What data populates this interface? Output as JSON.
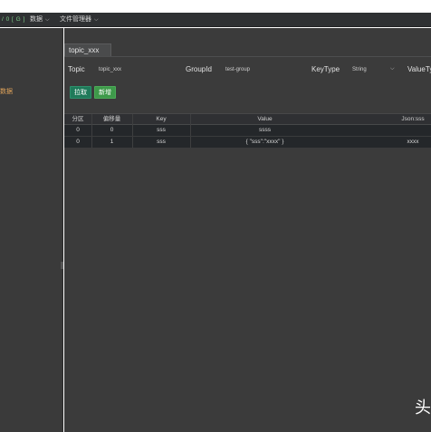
{
  "header": {
    "logo_text": "/ 0 [ G ]",
    "menu": [
      {
        "label": "数据",
        "icon": "chevron-down-icon"
      },
      {
        "label": "文件管理器",
        "icon": "chevron-down-icon"
      }
    ]
  },
  "sidebar": {
    "items": [
      {
        "label": "数据"
      }
    ]
  },
  "tabs": [
    {
      "label": "topic_xxx"
    }
  ],
  "form": {
    "topic_label": "Topic",
    "topic_value": "topic_xxx",
    "groupid_label": "GroupId",
    "groupid_value": "test-group",
    "keytype_label": "KeyType",
    "keytype_value": "String",
    "valuetype_label": "ValueTy"
  },
  "buttons": {
    "pull": "拉取",
    "add": "新增"
  },
  "table": {
    "columns": [
      "分区",
      "偏移量",
      "Key",
      "Value",
      "Json:sss"
    ],
    "rows": [
      [
        "0",
        "0",
        "sss",
        "ssss",
        ""
      ],
      [
        "0",
        "1",
        "sss",
        "{ \"sss\":\"xxxx\" }",
        "xxxx"
      ]
    ]
  },
  "watermark_char": "头",
  "colors": {
    "accent_green": "#3e9a4a",
    "accent_teal": "#1f7a5a",
    "sidebar_highlight": "#e0a35a"
  }
}
